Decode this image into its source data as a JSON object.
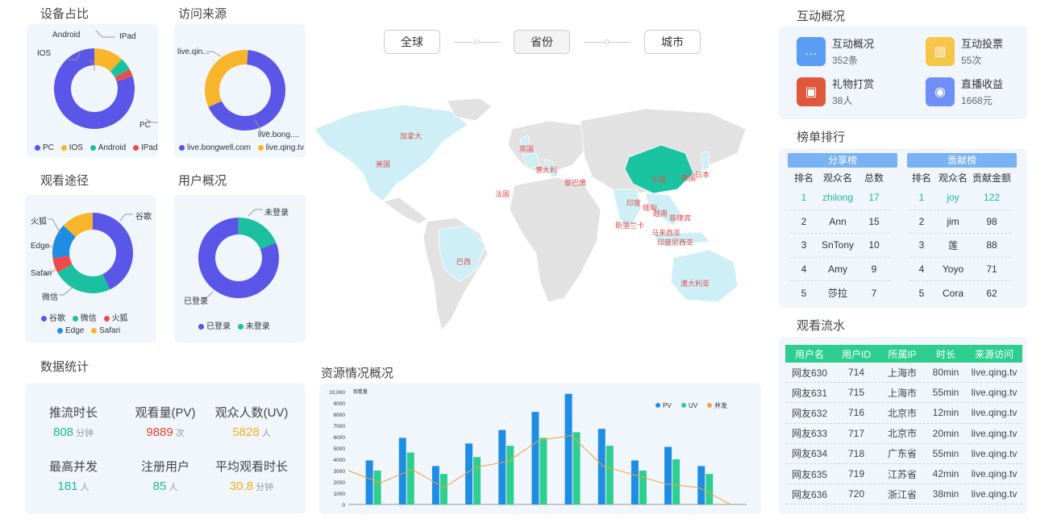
{
  "titles": {
    "device": "设备占比",
    "source": "访问来源",
    "path": "观看途径",
    "user": "用户概况",
    "stats": "数据统计",
    "resource": "资源情况概况",
    "interact": "互动概况",
    "rank": "榜单排行",
    "flow": "观看流水"
  },
  "device_chart": {
    "legend": [
      "PC",
      "IOS",
      "Android",
      "IPad"
    ],
    "labels": [
      "PC",
      "IOS",
      "Android",
      "IPad"
    ],
    "colors": [
      "#5a56e8",
      "#f7b52b",
      "#1bc0a0",
      "#ef4a4a"
    ]
  },
  "source_chart": {
    "labels": [
      "live.qin...",
      "live.bong...."
    ],
    "legend": [
      "live.bongwell.com",
      "live.qing.tv"
    ],
    "colors": [
      "#5a56e8",
      "#f7b52b"
    ]
  },
  "path_chart": {
    "labels": [
      "谷歌",
      "火狐",
      "Edge",
      "Safari",
      "微信"
    ],
    "legend": [
      "谷歌",
      "微信",
      "火狐",
      "Edge",
      "Safari"
    ],
    "colors": [
      "#5a56e8",
      "#1bc0a0",
      "#ef4a4a",
      "#1e8de3",
      "#f7b52b"
    ]
  },
  "user_chart": {
    "labels": [
      "未登录",
      "已登录"
    ],
    "legend": [
      "已登录",
      "未登录"
    ],
    "colors": [
      "#5a56e8",
      "#1bc0a0"
    ]
  },
  "stats": [
    {
      "title": "推流时长",
      "value": "808",
      "unit": "分钟",
      "color": "#1bb99a"
    },
    {
      "title": "观看量(PV)",
      "value": "9889",
      "unit": "次",
      "color": "#e0482c"
    },
    {
      "title": "观众人数(UV)",
      "value": "5828",
      "unit": "人",
      "color": "#f2b020"
    },
    {
      "title": "最高并发",
      "value": "181",
      "unit": "人",
      "color": "#1bb99a"
    },
    {
      "title": "注册用户",
      "value": "85",
      "unit": "人",
      "color": "#1bb99a"
    },
    {
      "title": "平均观看时长",
      "value": "30.8",
      "unit": "分钟",
      "color": "#f2b020"
    }
  ],
  "region_tabs": [
    "全球",
    "省份",
    "城市"
  ],
  "map_labels": [
    "加拿大",
    "美国",
    "英国",
    "意大利",
    "法国",
    "黎巴嫩",
    "巴西",
    "中国",
    "韩国",
    "日本",
    "印度",
    "缅甸",
    "越南",
    "菲律宾",
    "斯里兰卡",
    "马来西亚",
    "印度尼西亚",
    "澳大利亚"
  ],
  "interact": [
    {
      "title": "互动概况",
      "value": "352条",
      "color": "#5b9cf4",
      "icon": "chat-icon"
    },
    {
      "title": "互动投票",
      "value": "55次",
      "color": "#f7c548",
      "icon": "vote-icon"
    },
    {
      "title": "礼物打赏",
      "value": "38人",
      "color": "#e0583c",
      "icon": "gift-icon"
    },
    {
      "title": "直播收益",
      "value": "1668元",
      "color": "#6f8ff7",
      "icon": "income-icon"
    }
  ],
  "rank": {
    "share": {
      "title": "分享榜",
      "headers": [
        "排名",
        "观众名",
        "总数"
      ],
      "rows": [
        [
          "1",
          "zhilong",
          "17"
        ],
        [
          "2",
          "Ann",
          "15"
        ],
        [
          "3",
          "SnTony",
          "10"
        ],
        [
          "4",
          "Amy",
          "9"
        ],
        [
          "5",
          "莎拉",
          "7"
        ]
      ]
    },
    "contrib": {
      "title": "贡献榜",
      "headers": [
        "排名",
        "观众名",
        "贡献金额"
      ],
      "rows": [
        [
          "1",
          "joy",
          "122"
        ],
        [
          "2",
          "jim",
          "98"
        ],
        [
          "3",
          "莲",
          "88"
        ],
        [
          "4",
          "Yoyo",
          "71"
        ],
        [
          "5",
          "Cora",
          "62"
        ]
      ]
    }
  },
  "flow": {
    "headers": [
      "用户名",
      "用户ID",
      "所属IP",
      "时长",
      "来源访问"
    ],
    "rows": [
      [
        "网友630",
        "714",
        "上海市",
        "80min",
        "live.qing.tv"
      ],
      [
        "网友631",
        "715",
        "上海市",
        "55min",
        "live.qing.tv"
      ],
      [
        "网友632",
        "716",
        "北京市",
        "12min",
        "live.qing.tv"
      ],
      [
        "网友633",
        "717",
        "北京市",
        "20min",
        "live.qing.tv"
      ],
      [
        "网友634",
        "718",
        "广东省",
        "55min",
        "live.qing.tv"
      ],
      [
        "网友635",
        "719",
        "江苏省",
        "42min",
        "live.qing.tv"
      ],
      [
        "网友636",
        "720",
        "浙江省",
        "38min",
        "live.qing.tv"
      ]
    ]
  },
  "chart_data": [
    {
      "type": "pie",
      "categories": [
        "PC",
        "IOS",
        "Android",
        "IPad"
      ],
      "values": [
        80,
        12,
        5,
        3
      ]
    },
    {
      "type": "pie",
      "categories": [
        "live.bongwell.com",
        "live.qing.tv"
      ],
      "values": [
        67,
        33
      ]
    },
    {
      "type": "pie",
      "categories": [
        "谷歌",
        "微信",
        "火狐",
        "Edge",
        "Safari"
      ],
      "values": [
        43,
        24,
        6,
        14,
        13
      ]
    },
    {
      "type": "pie",
      "categories": [
        "已登录",
        "未登录"
      ],
      "values": [
        81,
        19
      ]
    },
    {
      "type": "bar",
      "ylabel": "观看量",
      "ylim": [
        0,
        10000
      ],
      "yticks": [
        "0",
        "1000",
        "2000",
        "3000",
        "4000",
        "5000",
        "6000",
        "7000",
        "8000",
        "9000",
        "10,000"
      ],
      "legend": [
        "PV",
        "UV",
        "并发"
      ],
      "series": [
        {
          "name": "PV",
          "values": [
            3900,
            5900,
            3400,
            5400,
            6600,
            8200,
            9800,
            6700,
            3900,
            5100,
            3400
          ],
          "color": "#1e8de3"
        },
        {
          "name": "UV",
          "values": [
            3000,
            4600,
            2700,
            4200,
            5200,
            5900,
            6400,
            5200,
            3000,
            4000,
            2700
          ],
          "color": "#2ecf8e"
        },
        {
          "name": "并发",
          "values": [
            3000,
            1900,
            3100,
            1500,
            3300,
            3800,
            5700,
            6100,
            3400,
            2600,
            1800,
            1500,
            0
          ],
          "color": "#f0a040"
        }
      ]
    }
  ]
}
